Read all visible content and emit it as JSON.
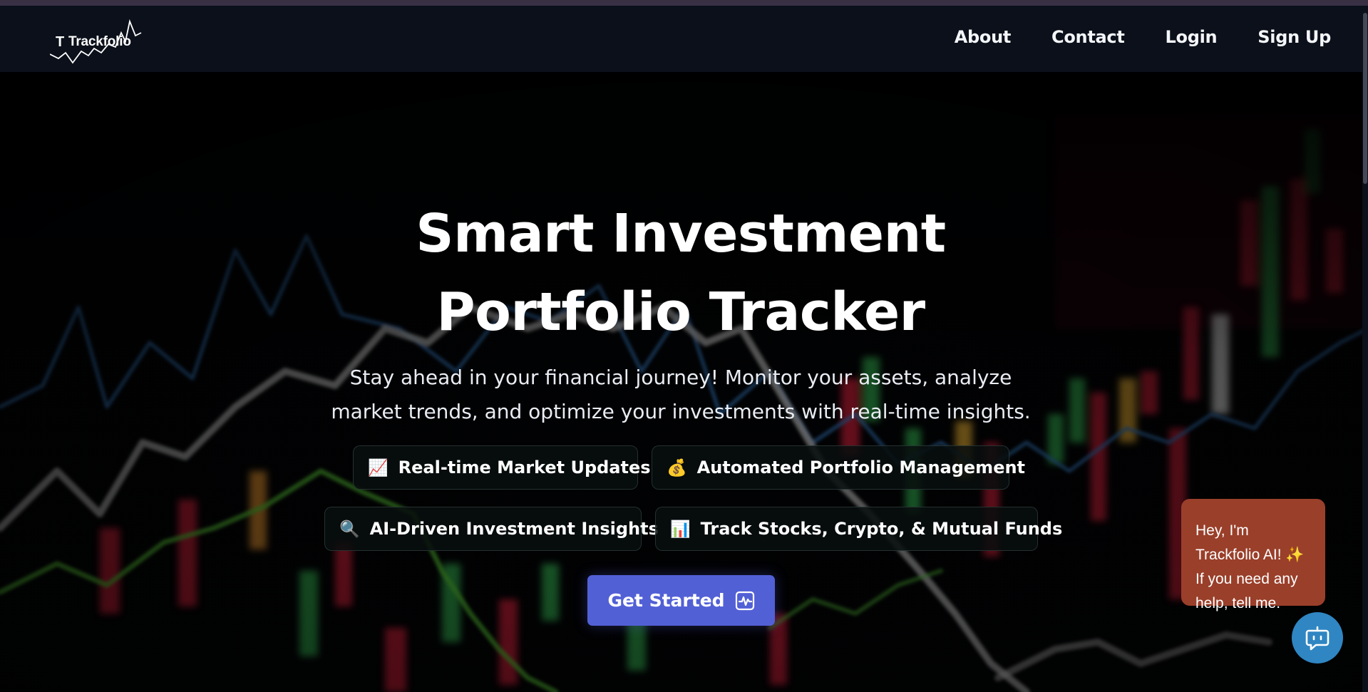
{
  "brand": {
    "name": "Trackfolio",
    "mark": "T"
  },
  "nav": {
    "links": [
      "About",
      "Contact",
      "Login",
      "Sign Up"
    ]
  },
  "hero": {
    "title": "Smart Investment Portfolio Tracker",
    "subtitle": "Stay ahead in your financial journey! Monitor your assets, analyze market trends, and optimize your investments with real-time insights.",
    "features": [
      {
        "icon": "chart-increasing-icon",
        "emoji": "📈",
        "label": "Real-time Market Updates"
      },
      {
        "icon": "money-bag-icon",
        "emoji": "💰",
        "label": "Automated Portfolio Management"
      },
      {
        "icon": "magnifying-glass-icon",
        "emoji": "🔍",
        "label": "AI-Driven Investment Insights"
      },
      {
        "icon": "bar-chart-icon",
        "emoji": "📊",
        "label": "Track Stocks, Crypto, & Mutual Funds"
      }
    ],
    "cta_label": "Get Started",
    "cta_icon": "activity-chart-icon"
  },
  "chat": {
    "message": "Hey, I'm Trackfolio AI! ✨ If you need any help, tell me.",
    "fab_icon": "chatbot-icon"
  },
  "colors": {
    "navbar": "#0b101a",
    "cta": "#5260d6",
    "chat_bubble": "#9a3f2a",
    "chat_fab": "#2f86c2"
  }
}
